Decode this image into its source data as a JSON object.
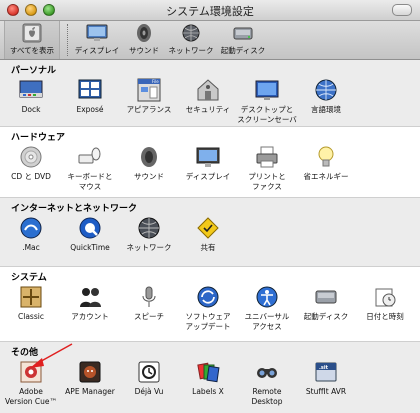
{
  "window": {
    "title": "システム環境設定"
  },
  "toolbar": [
    {
      "key": "showall",
      "label": "すべてを表示"
    },
    {
      "key": "display",
      "label": "ディスプレイ"
    },
    {
      "key": "sound",
      "label": "サウンド"
    },
    {
      "key": "network",
      "label": "ネットワーク"
    },
    {
      "key": "startup",
      "label": "起動ディスク"
    }
  ],
  "sections": [
    {
      "title": "パーソナル",
      "panes": [
        {
          "label": "Dock",
          "icon": "dock-icon"
        },
        {
          "label": "Exposé",
          "icon": "expose-icon"
        },
        {
          "label": "アピアランス",
          "icon": "appearance-icon"
        },
        {
          "label": "セキュリティ",
          "icon": "security-icon"
        },
        {
          "label": "デスクトップと\nスクリーンセーバ",
          "icon": "desktop-screensaver-icon"
        },
        {
          "label": "言語環境",
          "icon": "international-icon"
        }
      ]
    },
    {
      "title": "ハードウェア",
      "panes": [
        {
          "label": "CD と DVD",
          "icon": "cd-dvd-icon"
        },
        {
          "label": "キーボードと\nマウス",
          "icon": "keyboard-mouse-icon"
        },
        {
          "label": "サウンド",
          "icon": "sound-icon"
        },
        {
          "label": "ディスプレイ",
          "icon": "display-icon"
        },
        {
          "label": "プリントと\nファクス",
          "icon": "print-fax-icon"
        },
        {
          "label": "省エネルギー",
          "icon": "energy-saver-icon"
        }
      ]
    },
    {
      "title": "インターネットとネットワーク",
      "panes": [
        {
          "label": ".Mac",
          "icon": "mac-icon"
        },
        {
          "label": "QuickTime",
          "icon": "quicktime-icon"
        },
        {
          "label": "ネットワーク",
          "icon": "network-icon"
        },
        {
          "label": "共有",
          "icon": "sharing-icon"
        }
      ]
    },
    {
      "title": "システム",
      "panes": [
        {
          "label": "Classic",
          "icon": "classic-icon"
        },
        {
          "label": "アカウント",
          "icon": "accounts-icon"
        },
        {
          "label": "スピーチ",
          "icon": "speech-icon"
        },
        {
          "label": "ソフトウェア\nアップデート",
          "icon": "software-update-icon"
        },
        {
          "label": "ユニバーサル\nアクセス",
          "icon": "universal-access-icon"
        },
        {
          "label": "起動ディスク",
          "icon": "startup-disk-icon"
        },
        {
          "label": "日付と時刻",
          "icon": "date-time-icon"
        }
      ]
    },
    {
      "title": "その他",
      "panes": [
        {
          "label": "Adobe\nVersion Cue™",
          "icon": "adobe-version-cue-icon"
        },
        {
          "label": "APE Manager",
          "icon": "ape-manager-icon"
        },
        {
          "label": "Déjà Vu",
          "icon": "deja-vu-icon"
        },
        {
          "label": "Labels X",
          "icon": "labels-x-icon"
        },
        {
          "label": "Remote\nDesktop",
          "icon": "remote-desktop-icon"
        },
        {
          "label": "StuffIt AVR",
          "icon": "stuffit-avr-icon"
        }
      ]
    }
  ],
  "annotation": {
    "icon": "red-arrow-icon",
    "color": "#e02020"
  }
}
